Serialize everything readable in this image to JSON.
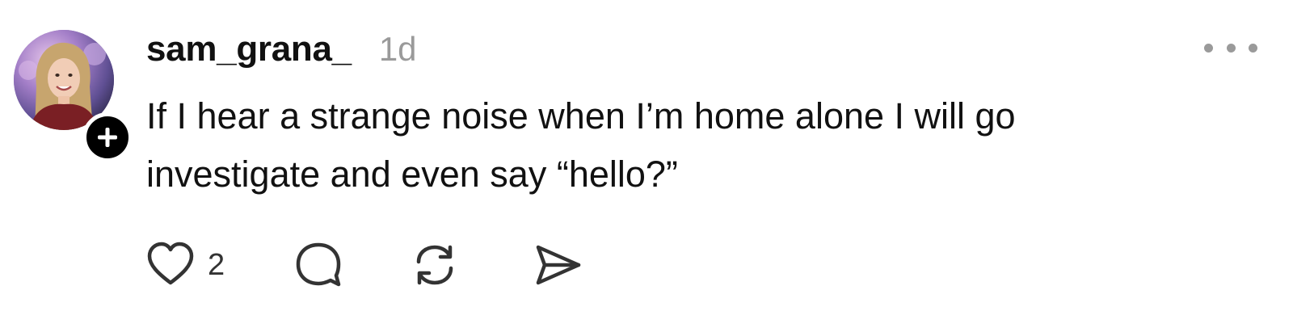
{
  "post": {
    "author": {
      "username": "sam_grana_",
      "avatar_icon": "profile-photo",
      "follow_icon": "plus-icon"
    },
    "timestamp": "1d",
    "more_icon": "ellipsis-icon",
    "text": "If I hear a strange noise when I’m home alone I will go\ninvestigate and even say “hello?”",
    "actions": {
      "like": {
        "icon": "heart-icon",
        "count": "2"
      },
      "reply": {
        "icon": "comment-bubble-icon"
      },
      "repost": {
        "icon": "repost-icon"
      },
      "share": {
        "icon": "send-icon"
      }
    }
  },
  "colors": {
    "text": "#111111",
    "muted": "#9a9a9a",
    "icon": "#333333",
    "badge": "#000000",
    "background": "#ffffff"
  }
}
